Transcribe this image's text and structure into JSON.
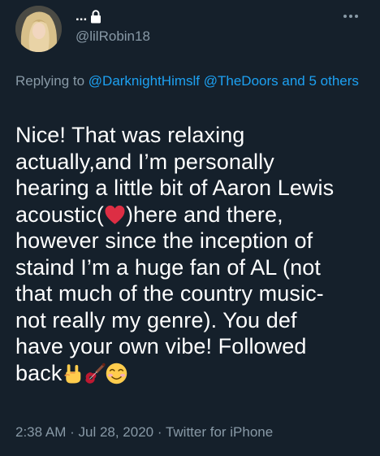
{
  "author": {
    "display_name": "...",
    "handle": "@lilRobin18"
  },
  "reply": {
    "prefix": "Replying to ",
    "mention_1": "@DarknightHimslf",
    "mention_2": "@TheDoors",
    "and_text": " and ",
    "others": "5 others"
  },
  "tweet": {
    "line1": "Nice! That was relaxing",
    "line2": "actually,and I’m personally",
    "line3": "hearing a little bit of Aaron Lewis",
    "line4_before": "acoustic(",
    "line4_after": ")here and there,",
    "line5": "however since the inception of",
    "line6": "staind I’m a huge fan of AL (not",
    "line7": "that much of the country music-",
    "line8": "not really my genre). You def",
    "line9": "have your own vibe! Followed",
    "line10": "back",
    "emojis": [
      "red-heart",
      "sign-of-the-horns",
      "guitar",
      "smiling-face-with-smiling-eyes"
    ]
  },
  "meta": {
    "time": "2:38 AM",
    "sep1": " · ",
    "date": "Jul 28, 2020",
    "sep2": " · ",
    "source": "Twitter for iPhone"
  },
  "colors": {
    "background": "#15202b",
    "secondary_text": "#8899a6",
    "accent": "#1da1f2",
    "heart": "#e0245e"
  }
}
